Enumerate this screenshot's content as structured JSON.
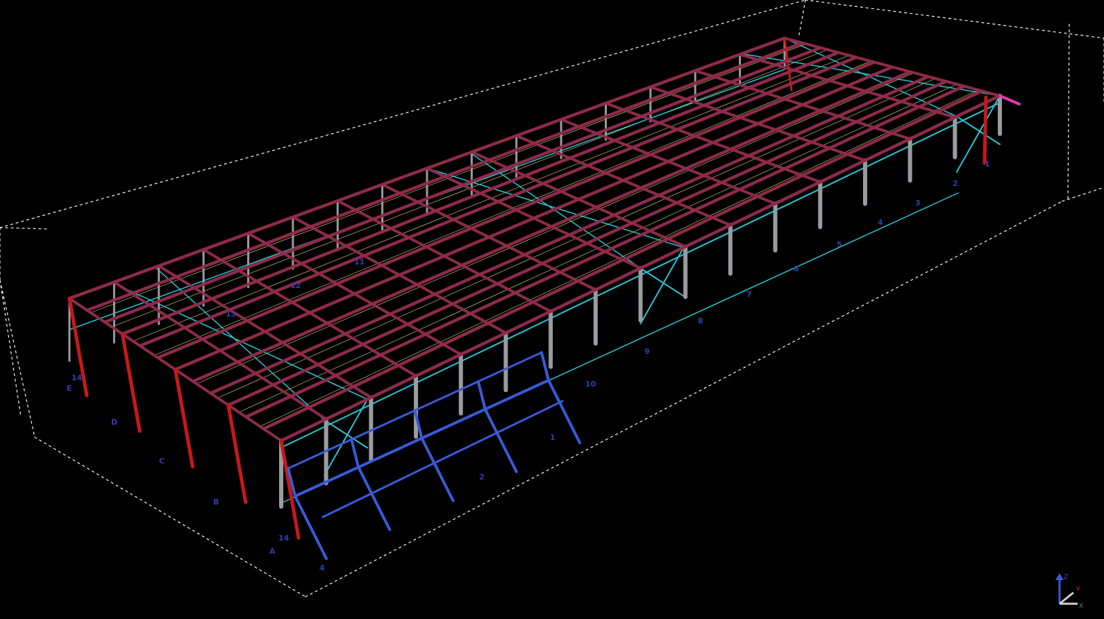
{
  "viewport": {
    "background": "#000000",
    "colors": {
      "bounding_box": "#ffffff",
      "rafters": "#8e2a4a",
      "gable_columns": "#c81818",
      "columns": "#9a9aa0",
      "bracing": "#29c6d6",
      "tie_lines": "#e8e870",
      "canopy": "#3a5ad8",
      "grid_labels": "#2b3fb0",
      "accent_end": "#e03ab0"
    }
  },
  "grid_labels": {
    "axes_letters": [
      "E",
      "D",
      "C",
      "B",
      "A"
    ],
    "axes_numbers": [
      "14",
      "14",
      "13",
      "12",
      "11",
      "10",
      "9",
      "8",
      "7",
      "6",
      "5",
      "4",
      "3",
      "2",
      "1",
      "1",
      "2",
      "4"
    ]
  },
  "axis_triad": {
    "x": "X",
    "y": "Y",
    "z": "Z"
  }
}
